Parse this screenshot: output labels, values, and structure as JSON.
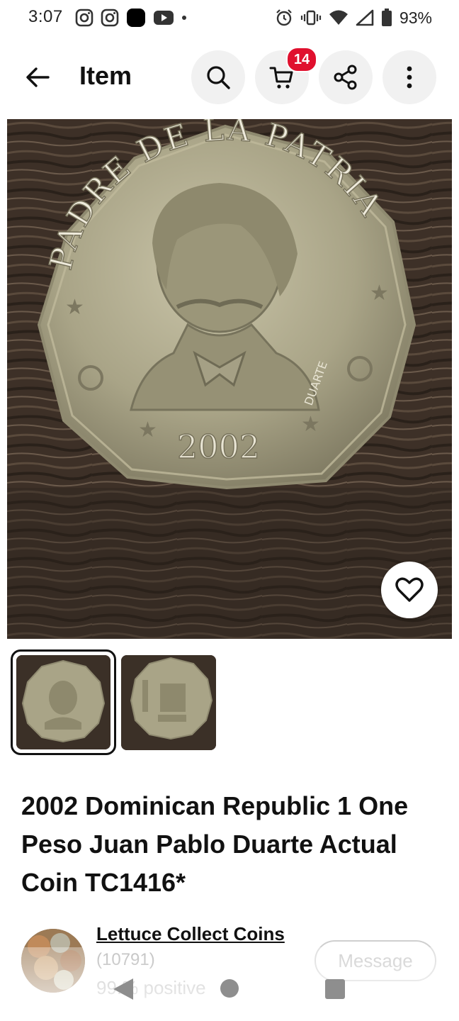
{
  "status_bar": {
    "time": "3:07",
    "left_icons": [
      "instagram-icon",
      "instagram-icon",
      "app-icon",
      "youtube-icon",
      "dot-icon"
    ],
    "right_icons": [
      "alarm-icon",
      "vibrate-icon",
      "wifi-icon",
      "signal-icon",
      "battery-icon"
    ],
    "battery": "93%"
  },
  "app_bar": {
    "title": "Item",
    "back_icon": "arrow-left-icon",
    "search_icon": "search-icon",
    "cart_icon": "cart-icon",
    "cart_count": "14",
    "share_icon": "share-icon",
    "more_icon": "more-vert-icon"
  },
  "gallery": {
    "main_image": "coin-obverse-photo",
    "coin_legend": "PADRE DE LA PATRIA",
    "coin_year": "2002",
    "coin_name": "DUARTE",
    "favorite_icon": "heart-icon",
    "thumbnails": [
      {
        "name": "coin-obverse-thumbnail",
        "selected": true
      },
      {
        "name": "coin-reverse-thumbnail",
        "selected": false
      }
    ]
  },
  "item": {
    "title": "2002 Dominican Republic 1 One Peso Juan Pablo Duarte Actual Coin TC1416*"
  },
  "seller": {
    "name": "Lettuce Collect Coins",
    "feedback_count": "(10791)",
    "positive": "99.% positive",
    "message_label": "Message"
  },
  "nav_bar": {
    "back": "nav-back-icon",
    "home": "nav-home-icon",
    "recents": "nav-recents-icon"
  },
  "colors": {
    "badge": "#e0102e",
    "button_bg": "#f1f1f1",
    "text": "#111111"
  }
}
